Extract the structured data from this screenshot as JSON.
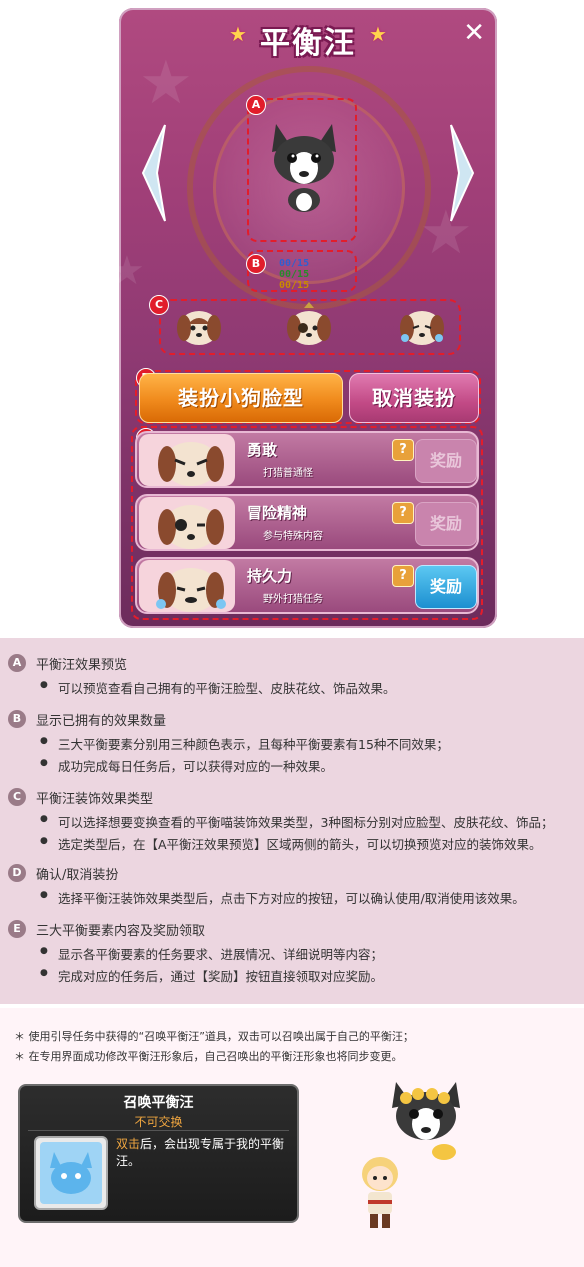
{
  "panel": {
    "title": "平衡汪",
    "close_glyph": "✕",
    "counters": [
      "00/15",
      "00/15",
      "00/15"
    ],
    "counter_colors": [
      "#2f5fd0",
      "#2a8a2a",
      "#c98a00"
    ],
    "tags": [
      "A",
      "B",
      "C",
      "D",
      "E"
    ],
    "wear_button": "装扮小狗脸型",
    "cancel_button": "取消装扮",
    "rows": [
      {
        "title": "勇敢",
        "subtitle": "打猎普通怪",
        "help": "?",
        "reward": "奖励",
        "enabled": false
      },
      {
        "title": "冒险精神",
        "subtitle": "参与特殊内容",
        "help": "?",
        "reward": "奖励",
        "enabled": false
      },
      {
        "title": "持久力",
        "subtitle": "野外打猎任务",
        "help": "?",
        "reward": "奖励",
        "enabled": true
      }
    ],
    "accent_colors": {
      "wear": "#f08a1c",
      "cancel": "#c24a86",
      "dash": "#e21d2b"
    }
  },
  "guide": {
    "sections": [
      {
        "badge": "A",
        "heading": "平衡汪效果预览",
        "items": [
          "可以预览查看自己拥有的平衡汪脸型、皮肤花纹、饰品效果。"
        ]
      },
      {
        "badge": "B",
        "heading": "显示已拥有的效果数量",
        "items": [
          "三大平衡要素分别用三种颜色表示，且每种平衡要素有15种不同效果；",
          "成功完成每日任务后，可以获得对应的一种效果。"
        ]
      },
      {
        "badge": "C",
        "heading": "平衡汪装饰效果类型",
        "items": [
          "可以选择想要变换查看的平衡喵装饰效果类型，3种图标分别对应脸型、皮肤花纹、饰品；",
          "选定类型后，在【A平衡汪效果预览】区域两侧的箭头，可以切换预览对应的装饰效果。"
        ]
      },
      {
        "badge": "D",
        "heading": "确认/取消装扮",
        "items": [
          "选择平衡汪装饰效果类型后，点击下方对应的按钮，可以确认使用/取消使用该效果。"
        ]
      },
      {
        "badge": "E",
        "heading": "三大平衡要素内容及奖励领取",
        "items": [
          "显示各平衡要素的任务要求、进展情况、详细说明等内容；",
          "完成对应的任务后，通过【奖励】按钮直接领取对应奖励。"
        ]
      }
    ]
  },
  "notes": [
    "＊ 使用引导任务中获得的“召唤平衡汪”道具，双击可以召唤出属于自己的平衡汪；",
    "＊ 在专用界面成功修改平衡汪形象后，自己召唤出的平衡汪形象也将同步变更。"
  ],
  "tooltip": {
    "title": "召唤平衡汪",
    "tradable": "不可交换",
    "desc_highlight": "双击",
    "desc_rest": "后，会出现专属于我的平衡汪。"
  }
}
